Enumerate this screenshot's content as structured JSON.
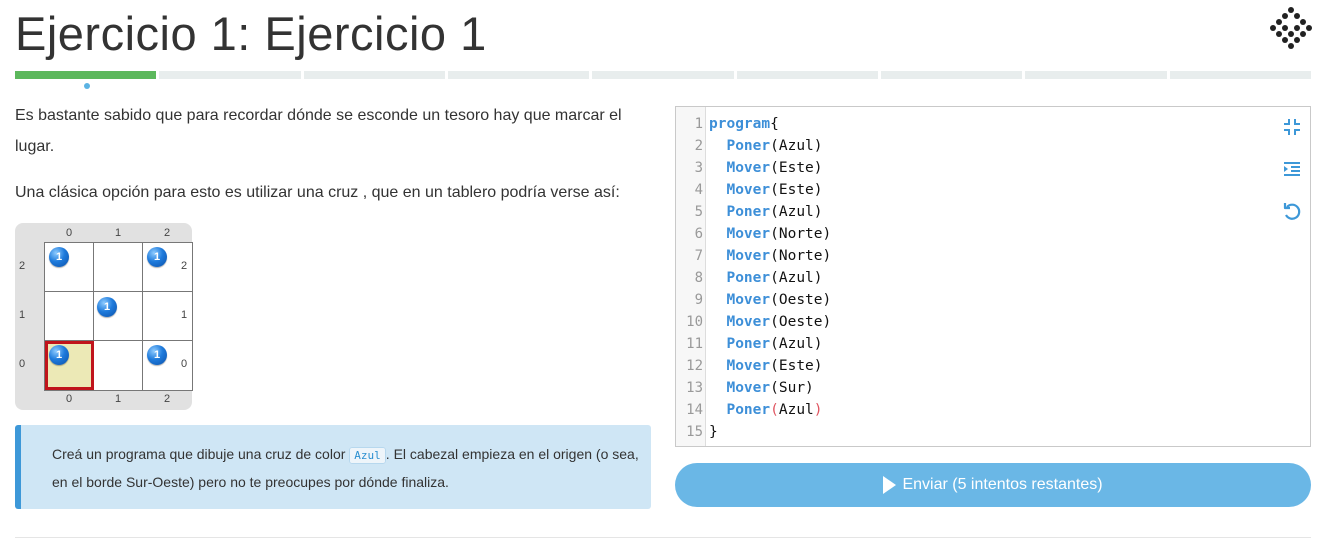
{
  "title": "Ejercicio 1: Ejercicio 1",
  "logo_icon": "mumuki-logo-icon",
  "progress": {
    "segments": 9,
    "completed": 1
  },
  "description": {
    "p1": "Es bastante sabido que para recordar dónde se esconde un tesoro hay que marcar el lugar.",
    "p2": "Una clásica opción para esto es utilizar una cruz , que en un tablero podría verse así:"
  },
  "board": {
    "columns": [
      "0",
      "1",
      "2"
    ],
    "rows": [
      "2",
      "1",
      "0"
    ],
    "balls": [
      {
        "row": 2,
        "col": 0,
        "count": "1"
      },
      {
        "row": 2,
        "col": 2,
        "count": "1"
      },
      {
        "row": 1,
        "col": 1,
        "count": "1"
      },
      {
        "row": 0,
        "col": 0,
        "count": "1"
      },
      {
        "row": 0,
        "col": 2,
        "count": "1"
      }
    ],
    "head": {
      "row": 0,
      "col": 0
    },
    "ball_color": "#1f7bdc",
    "head_color": "#c0141b"
  },
  "callout": {
    "before": "Creá un programa que dibuje una cruz de color ",
    "code": "Azul",
    "after": ". El cabezal empieza en el origen (o sea, en el borde Sur-Oeste) pero no te preocupes por dónde finaliza."
  },
  "editor": {
    "lines": [
      {
        "n": "1",
        "kw": "program",
        "rest": "{"
      },
      {
        "n": "2",
        "kw": "Poner",
        "rest": "(Azul)",
        "indent": true
      },
      {
        "n": "3",
        "kw": "Mover",
        "rest": "(Este)",
        "indent": true
      },
      {
        "n": "4",
        "kw": "Mover",
        "rest": "(Este)",
        "indent": true
      },
      {
        "n": "5",
        "kw": "Poner",
        "rest": "(Azul)",
        "indent": true
      },
      {
        "n": "6",
        "kw": "Mover",
        "rest": "(Norte)",
        "indent": true
      },
      {
        "n": "7",
        "kw": "Mover",
        "rest": "(Norte)",
        "indent": true
      },
      {
        "n": "8",
        "kw": "Poner",
        "rest": "(Azul)",
        "indent": true
      },
      {
        "n": "9",
        "kw": "Mover",
        "rest": "(Oeste)",
        "indent": true
      },
      {
        "n": "10",
        "kw": "Mover",
        "rest": "(Oeste)",
        "indent": true
      },
      {
        "n": "11",
        "kw": "Poner",
        "rest": "(Azul)",
        "indent": true
      },
      {
        "n": "12",
        "kw": "Mover",
        "rest": "(Este)",
        "indent": true
      },
      {
        "n": "13",
        "kw": "Mover",
        "rest": "(Sur)",
        "indent": true
      },
      {
        "n": "14",
        "kw": "Poner",
        "rest": "(Azul)",
        "indent": true,
        "red_parens": true
      },
      {
        "n": "15",
        "kw": "",
        "rest": "}"
      }
    ],
    "tools": [
      "collapse-icon",
      "indent-icon",
      "reset-icon"
    ]
  },
  "submit": {
    "label": "Enviar (5 intentos restantes)",
    "icon": "play-icon"
  },
  "colors": {
    "accent": "#3d98d8",
    "progress_done": "#5cb85c",
    "keyword": "#3d8fd8"
  }
}
